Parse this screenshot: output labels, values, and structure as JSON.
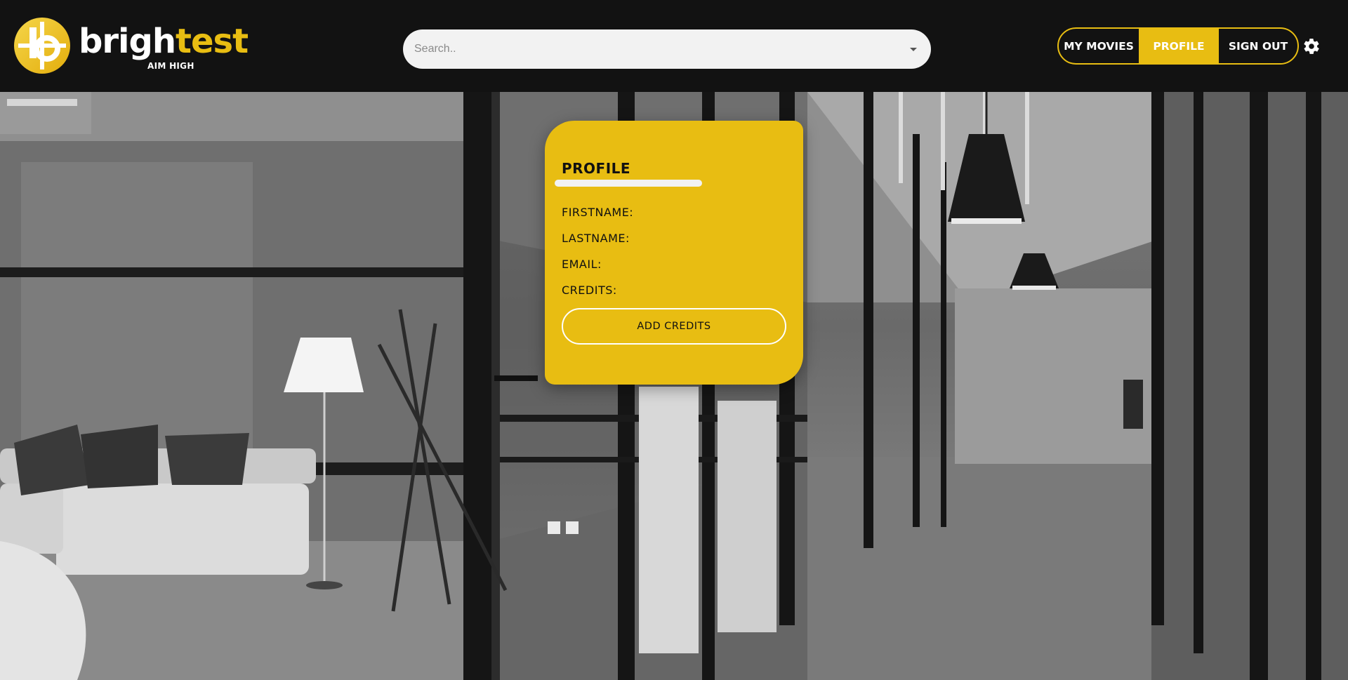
{
  "brand": {
    "word_part1": "brigh",
    "word_part2": "test",
    "tagline": "AIM HIGH",
    "accent_color": "#e8bd12",
    "logo_icon": "bt-logo-icon"
  },
  "search": {
    "placeholder": "Search..",
    "value": ""
  },
  "nav": {
    "items": [
      {
        "label": "MY MOVIES"
      },
      {
        "label": "PROFILE",
        "active": true
      },
      {
        "label": "SIGN OUT"
      }
    ],
    "settings_icon": "gear-icon"
  },
  "profile": {
    "title": "PROFILE",
    "fields": [
      {
        "label": "FIRSTNAME:",
        "value": ""
      },
      {
        "label": "LASTNAME:",
        "value": ""
      },
      {
        "label": "EMAIL:",
        "value": ""
      },
      {
        "label": "CREDITS:",
        "value": ""
      }
    ],
    "add_credits_label": "ADD CREDITS"
  },
  "colors": {
    "header_bg": "#121212",
    "accent": "#e8bd12",
    "search_bg": "#f2f2f2"
  }
}
